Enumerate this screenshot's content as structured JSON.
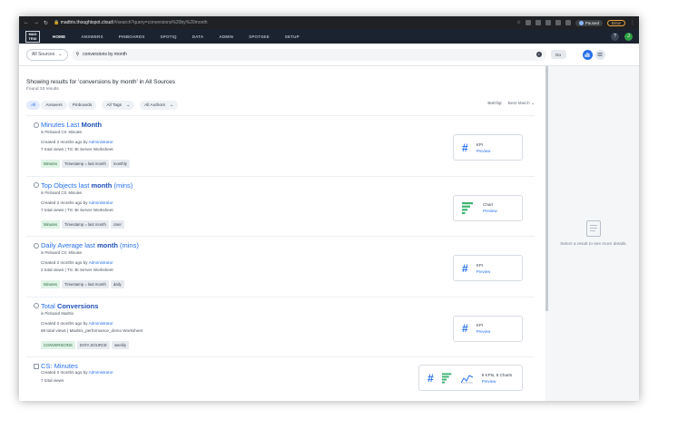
{
  "browser": {
    "url_host": "madtrix.thoughtspot.cloud",
    "url_path": "/#/search?query=conversions%20by%20month",
    "paused_label": "Paused",
    "error_label": "Error"
  },
  "app": {
    "logo_line1": "MAD",
    "logo_line2": "TRIX",
    "nav": [
      "HOME",
      "ANSWERS",
      "PINBOARDS",
      "SPOTIQ",
      "DATA",
      "ADMIN",
      "SPOTSEE",
      "SETUP"
    ],
    "help_label": "?",
    "user_initial": "J"
  },
  "search": {
    "sources_label": "All Sources",
    "query": "conversions by month",
    "go_label": "Go"
  },
  "results": {
    "title": "Showing results for 'conversions by month' in All Sources",
    "count": "Found 33 results",
    "filters": [
      "All",
      "Answers",
      "Pinboards"
    ],
    "tags_filter": "All Tags",
    "authors_filter": "All Authors",
    "sort_label": "Sort by:",
    "sort_value": "Best Match"
  },
  "items": [
    {
      "title_pre": "Minutes Last ",
      "title_bold": "Month",
      "title_post": "",
      "sub": "in Pinboard CS: Minutes",
      "created": "Created 2 months ago by ",
      "author": "Administrator",
      "views": "7 total views  |  TS: BI Server Worksheet",
      "tags": [
        "Minutes",
        "Timestamp = last month",
        "monthly"
      ],
      "card_label": "KPI",
      "card_preview": "Preview"
    },
    {
      "title_pre": "Top Objects last ",
      "title_bold": "month",
      "title_post": " (mins)",
      "sub": "in Pinboard CS: Minutes",
      "created": "Created 2 months ago by ",
      "author": "Administrator",
      "views": "7 total views  |  TS: BI Server Worksheet",
      "tags": [
        "Minutes",
        "Timestamp = last month",
        "User"
      ],
      "card_label": "Chart",
      "card_preview": "Preview"
    },
    {
      "title_pre": "Daily Average last ",
      "title_bold": "month",
      "title_post": " (mins)",
      "sub": "in Pinboard CS: Minutes",
      "created": "Created 2 months ago by ",
      "author": "Administrator",
      "views": "2 total views  |  TS: BI Server Worksheet",
      "tags": [
        "Minutes",
        "Timestamp = last month",
        "daily"
      ],
      "card_label": "KPI",
      "card_preview": "Preview"
    },
    {
      "title_pre": "Total ",
      "title_bold": "Conversions",
      "title_post": "",
      "sub": "in Pinboard Madtrix",
      "created": "Created 2 months ago by ",
      "author": "Administrator",
      "views": "69 total views  |  Madtrix_performance_demo Worksheet",
      "tags": [
        "CONVERSIONS",
        "DATA SOURCE",
        "weekly"
      ],
      "card_label": "KPI",
      "card_preview": "Preview"
    },
    {
      "title_pre": "CS: Minutes",
      "title_bold": "",
      "title_post": "",
      "sub": "",
      "created": "Created 2 months ago by ",
      "author": "Administrator",
      "views": "7 total views",
      "tags": [],
      "card_label": "6 KPIs, 6 Charts",
      "card_preview": "Preview"
    }
  ],
  "detail_pane": {
    "empty_text": "Select a result to see more details."
  }
}
